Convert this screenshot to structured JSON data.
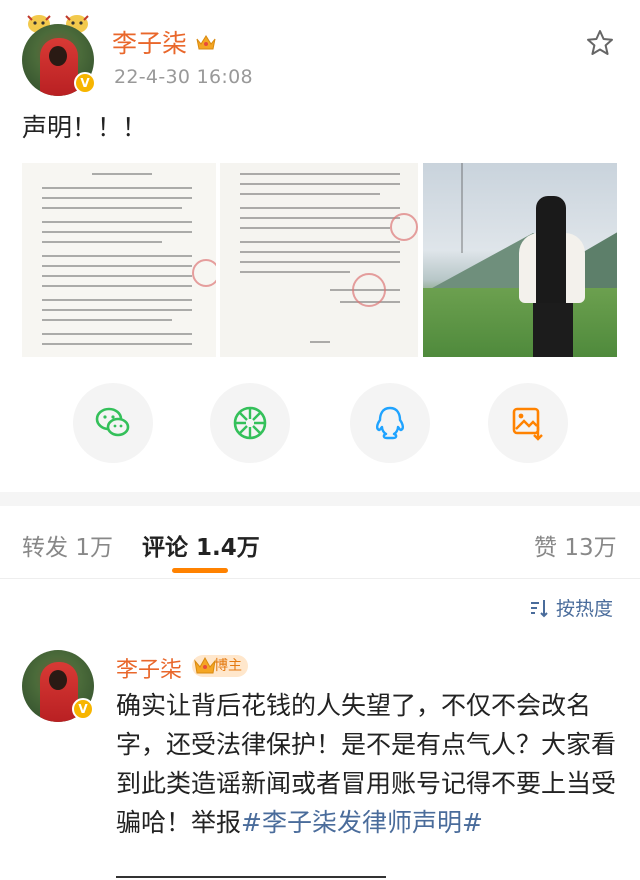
{
  "post": {
    "author": "李子柒",
    "time": "22-4-30 16:08",
    "text": "声明！！！",
    "images": [
      {
        "kind": "document",
        "icon": "document-image"
      },
      {
        "kind": "document",
        "icon": "document-image"
      },
      {
        "kind": "photo",
        "icon": "landscape-photo"
      }
    ]
  },
  "share": [
    {
      "icon": "wechat-icon"
    },
    {
      "icon": "moments-icon"
    },
    {
      "icon": "qq-icon"
    },
    {
      "icon": "save-image-icon"
    }
  ],
  "stats": {
    "repost_label": "转发",
    "repost_count": "1万",
    "comment_label": "评论",
    "comment_count": "1.4万",
    "like_label": "赞",
    "like_count": "13万"
  },
  "sort": {
    "label": "按热度"
  },
  "comment": {
    "author": "李子柒",
    "badge": "博主",
    "text_plain": "确实让背后花钱的人失望了，不仅不会改名字，还受法律保护！是不是有点气人？大家看到此类造谣新闻或者冒用账号记得不要上当受骗哈！举报",
    "hashtag": "#李子柒发律师声明#"
  },
  "colors": {
    "name": "#e9672b",
    "link": "#4a6c9b",
    "accent": "#ff8200",
    "verified": "#f7b500"
  }
}
